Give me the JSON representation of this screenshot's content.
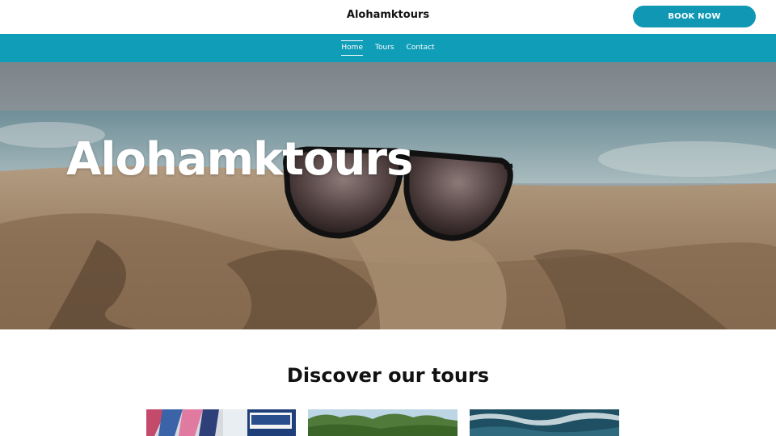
{
  "header": {
    "brand": "Alohamktours",
    "cta_label": "BOOK NOW"
  },
  "nav": {
    "items": [
      {
        "label": "Home",
        "active": true
      },
      {
        "label": "Tours",
        "active": false
      },
      {
        "label": "Contact",
        "active": false
      }
    ]
  },
  "hero": {
    "title": "Alohamktours",
    "image": "sunglasses-on-sand-beach"
  },
  "tours": {
    "heading": "Discover our tours",
    "cards": [
      {
        "image": "graffiti-mural-photo"
      },
      {
        "image": "green-mountains-photo"
      },
      {
        "image": "ocean-waves-photo"
      }
    ]
  },
  "colors": {
    "accent": "#0f97b3",
    "nav_bg": "#0f9db8",
    "text": "#111111"
  }
}
